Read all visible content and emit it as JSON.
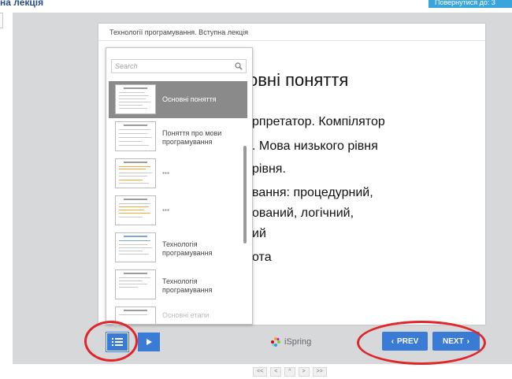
{
  "header": {
    "title_fragment": "на лекція",
    "return_button": "Повернутися до: 3"
  },
  "slide": {
    "title_bar": "Технології програмування. Вступна лекція",
    "heading": "овні поняття",
    "lines": [
      "рпретатор. Компілятор",
      ". Мова низького рівня",
      "рівня.",
      "вання: процедурний,",
      "ований, логічний,",
      "ий",
      "ота"
    ]
  },
  "outline": {
    "search_placeholder": "Search",
    "items": [
      {
        "label": "Основні поняття",
        "active": true
      },
      {
        "label": "Поняття про мови програмування",
        "active": false
      },
      {
        "label": "",
        "active": false
      },
      {
        "label": "",
        "active": false
      },
      {
        "label": "Технологія програмування",
        "active": false
      },
      {
        "label": "Технологія програмування",
        "active": false
      },
      {
        "label": "Основні етапи",
        "active": false
      }
    ]
  },
  "controls": {
    "outline_icon": "list-icon",
    "play_icon": "play-icon",
    "brand": "iSpring",
    "prev_label": "PREV",
    "next_label": "NEXT"
  },
  "pager": [
    "<<",
    "<",
    "^",
    ">",
    ">>"
  ],
  "colors": {
    "accent": "#3a7bd5",
    "annotation_red": "#e0262a",
    "active_item": "#8a8a8a",
    "player_bg": "#d6d8da"
  }
}
